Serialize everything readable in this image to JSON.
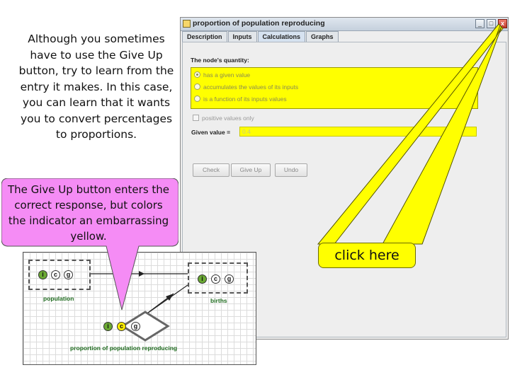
{
  "intro_text": "Although you sometimes have to use the Give Up button, try to learn from the entry it makes.  In this case, you can learn that it wants you to convert percentages to proportions.",
  "window": {
    "title": "proportion of population reproducing",
    "controls": {
      "minimize": "_",
      "maximize": "□",
      "close": "x"
    },
    "tabs": [
      "Description",
      "Inputs",
      "Calculations",
      "Graphs"
    ],
    "active_tab": "Calculations",
    "quantity_label": "The node's quantity:",
    "options": [
      "has a given value",
      "accumulates the values of its inputs",
      "is a function of its inputs values"
    ],
    "selected_option": "has a given value",
    "positive_only_label": "positive values only",
    "given_value_label": "Given value =",
    "given_value": "0.4",
    "buttons": {
      "check": "Check",
      "give_up": "Give Up",
      "undo": "Undo"
    }
  },
  "callouts": {
    "click_here": "click here",
    "give_up_note": "The Give Up button enters the correct response, but colors the indicator an embarrassing yellow."
  },
  "graph": {
    "nodes": [
      {
        "label": "population",
        "indicators": [
          "i",
          "c",
          "g"
        ]
      },
      {
        "label": "births",
        "indicators": [
          "i",
          "c",
          "g"
        ]
      },
      {
        "label": "proportion of population reproducing",
        "indicators": [
          "i",
          "c",
          "g"
        ]
      }
    ]
  },
  "colors": {
    "highlight_yellow": "#ffff00",
    "bubble_pink": "#f58cf5",
    "indicator_green": "#6aa933"
  }
}
